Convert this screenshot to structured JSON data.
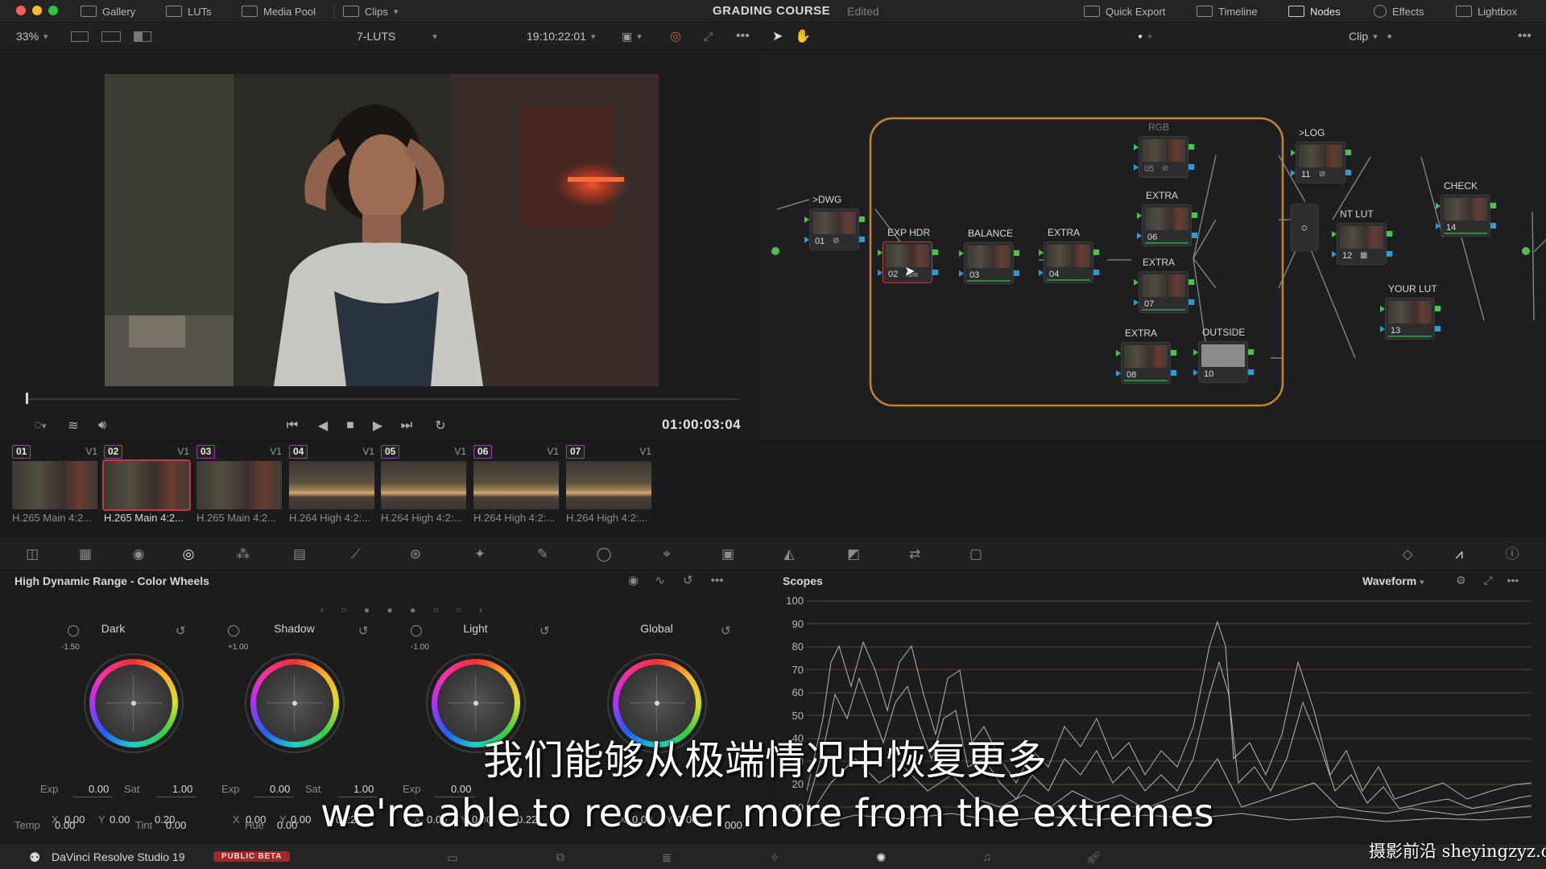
{
  "topbar": {
    "gallery": "Gallery",
    "luts": "LUTs",
    "media_pool": "Media Pool",
    "clips": "Clips",
    "project_title": "GRADING COURSE",
    "project_status": "Edited",
    "quick_export": "Quick Export",
    "timeline": "Timeline",
    "nodes": "Nodes",
    "effects": "Effects",
    "lightbox": "Lightbox"
  },
  "viewer_toolbar": {
    "zoom": "33%",
    "timeline_name": "7-LUTS",
    "timecode": "19:10:22:01"
  },
  "node_toolbar": {
    "mode": "Clip"
  },
  "viewer": {
    "playhead_timecode": "01:00:03:04"
  },
  "nodes": [
    {
      "id": "n01",
      "label": ">DWG",
      "num": "01"
    },
    {
      "id": "n02",
      "label": "EXP HDR",
      "num": "02"
    },
    {
      "id": "n03",
      "label": "BALANCE",
      "num": "03"
    },
    {
      "id": "n04",
      "label": "EXTRA",
      "num": "04"
    },
    {
      "id": "n05",
      "label": "RGB",
      "num": "05"
    },
    {
      "id": "n06",
      "label": "EXTRA",
      "num": "06"
    },
    {
      "id": "n07",
      "label": "EXTRA",
      "num": "07"
    },
    {
      "id": "n08",
      "label": "EXTRA",
      "num": "08"
    },
    {
      "id": "n10",
      "label": "OUTSIDE",
      "num": "10"
    },
    {
      "id": "n11",
      "label": ">LOG",
      "num": "11"
    },
    {
      "id": "n12",
      "label": "NT LUT",
      "num": "12"
    },
    {
      "id": "n13",
      "label": "YOUR LUT",
      "num": "13"
    },
    {
      "id": "n14",
      "label": "CHECK",
      "num": "14"
    }
  ],
  "clips": [
    {
      "num": "01",
      "track": "V1",
      "codec": "H.265 Main 4:2..."
    },
    {
      "num": "02",
      "track": "V1",
      "codec": "H.265 Main 4:2..."
    },
    {
      "num": "03",
      "track": "V1",
      "codec": "H.265 Main 4:2..."
    },
    {
      "num": "04",
      "track": "V1",
      "codec": "H.264 High 4:2:..."
    },
    {
      "num": "05",
      "track": "V1",
      "codec": "H.264 High 4:2:..."
    },
    {
      "num": "06",
      "track": "V1",
      "codec": "H.264 High 4:2:..."
    },
    {
      "num": "07",
      "track": "V1",
      "codec": "H.264 High 4:2:..."
    }
  ],
  "wheels_panel": {
    "title": "High Dynamic Range - Color Wheels",
    "groups": [
      {
        "name": "Dark",
        "zone_val": "-1.50",
        "exp": "0.00",
        "sat": "1.00",
        "x": "0.00",
        "y": "0.00",
        "z": "0.20"
      },
      {
        "name": "Shadow",
        "zone_val": "+1.00",
        "exp": "0.00",
        "sat": "1.00",
        "x": "0.00",
        "y": "0.00",
        "z": "0.22"
      },
      {
        "name": "Light",
        "zone_val": "-1.00",
        "exp": "0.00",
        "sat": "",
        "x": "0.00",
        "y": "0.00",
        "z": "0.22"
      },
      {
        "name": "Global",
        "zone_val": "",
        "exp": "",
        "sat": "",
        "x": "0.00",
        "y": "0.00",
        "z": ""
      }
    ],
    "labels": {
      "exp": "Exp",
      "sat": "Sat",
      "x": "X",
      "y": "Y"
    },
    "bottom": {
      "temp_label": "Temp",
      "temp": "0.00",
      "tint_label": "Tint",
      "tint": "0.00",
      "hue_label": "Hue",
      "hue": "0.00",
      "extra": "000"
    }
  },
  "scopes": {
    "title": "Scopes",
    "type": "Waveform",
    "ticks": [
      "100",
      "90",
      "80",
      "70",
      "60",
      "50",
      "40",
      "30",
      "20",
      "10"
    ]
  },
  "statusbar": {
    "app_name": "DaVinci Resolve Studio 19",
    "beta": "PUBLIC BETA"
  },
  "subtitles": {
    "cn": "我们能够从极端情况中恢复更多",
    "en": "we're able to recover more from the extremes"
  },
  "watermark": "摄影前沿 sheyingzyz.com",
  "colors": {
    "accent": "#d4862c",
    "selection": "#c53a3a",
    "node_link": "#4bc24b",
    "node_key": "#2d9ad0",
    "group_outline": "#c2882e"
  }
}
